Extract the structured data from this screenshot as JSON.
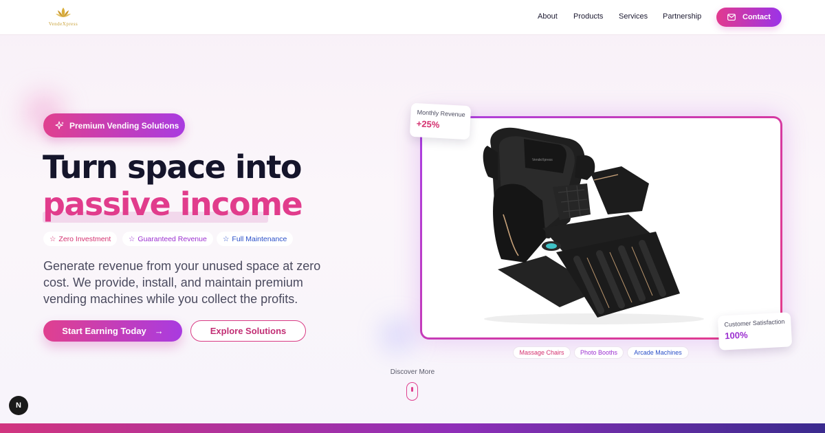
{
  "header": {
    "logo_text": "VendeXpress",
    "nav": [
      "About",
      "Products",
      "Services",
      "Partnership"
    ],
    "contact_label": "Contact"
  },
  "hero": {
    "badge": "Premium Vending Solutions",
    "headline_line1": "Turn space into",
    "headline_line2": "passive income",
    "tags": [
      {
        "label": "Zero Investment",
        "color": "#d4306f"
      },
      {
        "label": "Guaranteed Revenue",
        "color": "#9b2fd0"
      },
      {
        "label": "Full Maintenance",
        "color": "#2a4fc8"
      }
    ],
    "description": "Generate revenue from your unused space at zero cost. We provide, install, and maintain premium vending machines while you collect the profits.",
    "primary_cta": "Start Earning Today",
    "secondary_cta": "Explore Solutions"
  },
  "visual": {
    "image_name": "massage-chair",
    "chair_brand": "VendeXpress",
    "revenue_card": {
      "label": "Monthly Revenue",
      "value": "+25%"
    },
    "satisfaction_card": {
      "label": "Customer Satisfaction",
      "value": "100%"
    },
    "categories": [
      {
        "label": "Massage Chairs",
        "color": "#d4306f"
      },
      {
        "label": "Photo Booths",
        "color": "#9b2fd0"
      },
      {
        "label": "Arcade Machines",
        "color": "#2a4fc8"
      }
    ]
  },
  "scroll_hint": "Discover More",
  "dev_badge": "N",
  "colors": {
    "accent_pink": "#e0408f",
    "accent_purple": "#a93be0",
    "text_dark": "#15152b"
  }
}
